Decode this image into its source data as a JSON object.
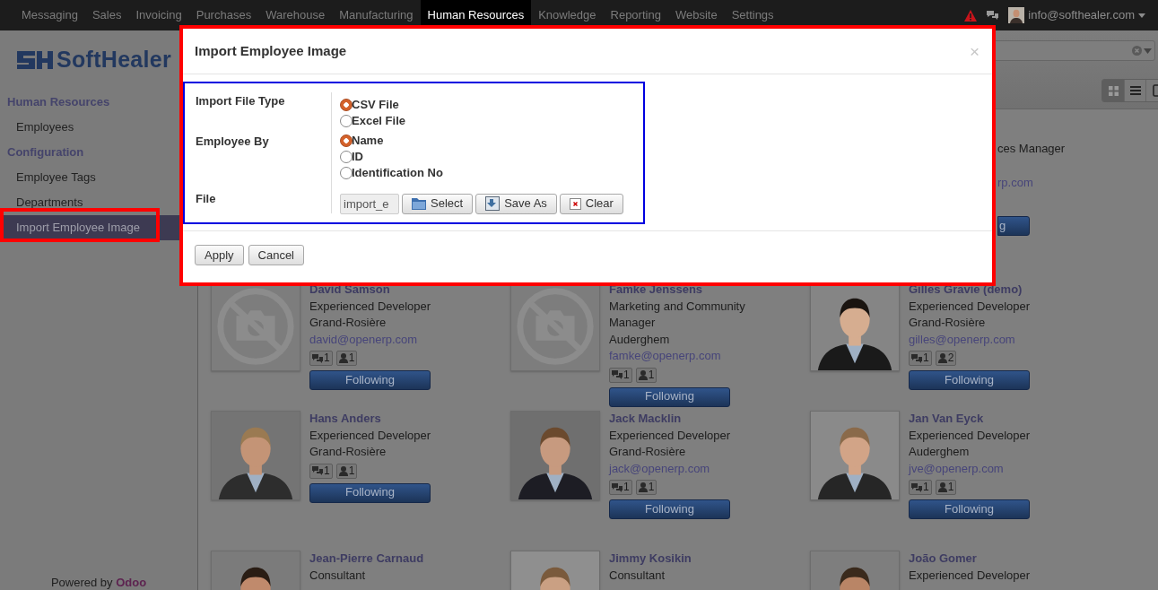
{
  "navbar": {
    "menu": [
      {
        "label": "Messaging",
        "selected": false
      },
      {
        "label": "Sales",
        "selected": false
      },
      {
        "label": "Invoicing",
        "selected": false
      },
      {
        "label": "Purchases",
        "selected": false
      },
      {
        "label": "Warehouse",
        "selected": false
      },
      {
        "label": "Manufacturing",
        "selected": false
      },
      {
        "label": "Human Resources",
        "selected": true
      },
      {
        "label": "Knowledge",
        "selected": false
      },
      {
        "label": "Reporting",
        "selected": false
      },
      {
        "label": "Website",
        "selected": false
      },
      {
        "label": "Settings",
        "selected": false
      }
    ],
    "user": "info@softhealer.com"
  },
  "sidebar": {
    "logo": "SoftHealer",
    "sections": [
      {
        "title": "Human Resources",
        "items": [
          {
            "label": "Employees",
            "selected": false
          }
        ]
      },
      {
        "title": "Configuration",
        "items": [
          {
            "label": "Employee Tags",
            "selected": false
          },
          {
            "label": "Departments",
            "selected": false
          },
          {
            "label": "Import Employee Image",
            "selected": true
          }
        ]
      }
    ],
    "footer": {
      "text": "Powered by",
      "link": "Odoo"
    }
  },
  "views": [
    {
      "kind": "kanban",
      "selected": true
    },
    {
      "kind": "list",
      "selected": false
    },
    {
      "kind": "form",
      "selected": false
    }
  ],
  "dialog": {
    "title": "Import Employee Image",
    "close": "×",
    "fields": [
      {
        "label": "Import File Type",
        "kind": "radio",
        "options": [
          {
            "label": "CSV File",
            "selected": true
          },
          {
            "label": "Excel File",
            "selected": false
          }
        ]
      },
      {
        "label": "Employee By",
        "kind": "radio",
        "options": [
          {
            "label": "Name",
            "selected": true
          },
          {
            "label": "ID",
            "selected": false
          },
          {
            "label": "Identification No",
            "selected": false
          }
        ]
      },
      {
        "label": "File",
        "kind": "file",
        "value": "import_e",
        "buttons": [
          {
            "label": "Select",
            "kind": "select"
          },
          {
            "label": "Save As",
            "kind": "save"
          },
          {
            "label": "Clear",
            "kind": "clear"
          }
        ]
      }
    ],
    "buttons": [
      "Apply",
      "Cancel"
    ]
  },
  "employees": [
    [
      {
        "kind": "fragment",
        "job": "ces Manager",
        "email": "rp.com",
        "button": "g"
      }
    ],
    [
      {
        "kind": "no_photo",
        "name": "David Samson",
        "job": "Experienced Developer",
        "city": "Grand-Rosière",
        "email": "david@openerp.com",
        "messages": "1",
        "followers": "1",
        "button": "Following"
      },
      {
        "kind": "no_photo",
        "name": "Famke Jenssens",
        "job": "Marketing and Community Manager",
        "city": "Auderghem",
        "email": "famke@openerp.com",
        "messages": "1",
        "followers": "1",
        "button": "Following"
      },
      {
        "name": "Gilles Gravie (demo)",
        "job": "Experienced Developer",
        "city": "Grand-Rosière",
        "email": "gilles@openerp.com",
        "messages": "1",
        "followers": "2",
        "button": "Following"
      }
    ],
    [
      {
        "name": "Hans Anders",
        "job": "Experienced Developer",
        "city": "Grand-Rosière",
        "messages": "1",
        "followers": "1",
        "button": "Following"
      },
      {
        "name": "Jack Macklin",
        "job": "Experienced Developer",
        "city": "Grand-Rosière",
        "email": "jack@openerp.com",
        "messages": "1",
        "followers": "1",
        "button": "Following"
      },
      {
        "name": "Jan Van Eyck",
        "job": "Experienced Developer",
        "city": "Auderghem",
        "email": "jve@openerp.com",
        "messages": "1",
        "followers": "1",
        "button": "Following"
      }
    ],
    [
      {
        "name": "Jean-Pierre Carnaud",
        "job": "Consultant"
      },
      {
        "name": "Jimmy Kosikin",
        "job": "Consultant"
      },
      {
        "name": "João Gomer",
        "job": "Experienced Developer"
      }
    ]
  ]
}
